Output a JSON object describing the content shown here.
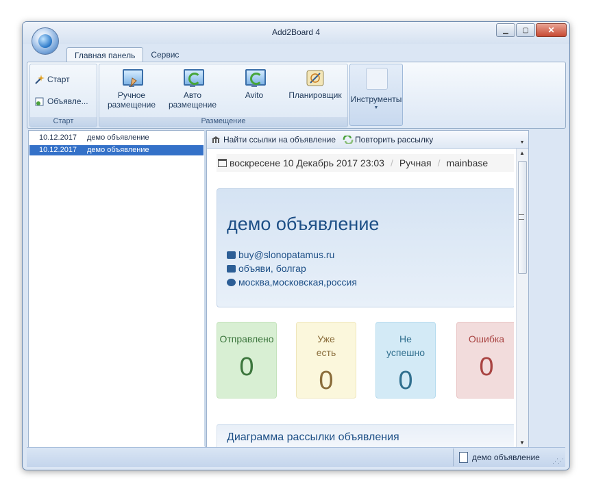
{
  "window": {
    "title": "Add2Board 4"
  },
  "tabs": [
    {
      "label": "Главная панель",
      "active": true
    },
    {
      "label": "Сервис",
      "active": false
    }
  ],
  "ribbon": {
    "start_group": {
      "label": "Старт",
      "buttons": [
        {
          "label": "Старт",
          "icon": "wizard-icon"
        },
        {
          "label": "Объявле...",
          "icon": "ad-icon"
        }
      ]
    },
    "placement_group": {
      "label": "Размещение",
      "buttons": [
        {
          "line1": "Ручное",
          "line2": "размещение",
          "icon": "manual-placement-icon"
        },
        {
          "line1": "Авто",
          "line2": "размещение",
          "icon": "auto-placement-icon"
        },
        {
          "line1": "Avito",
          "line2": "",
          "icon": "avito-icon"
        },
        {
          "line1": "Планировщик",
          "line2": "",
          "icon": "scheduler-icon"
        }
      ]
    },
    "tools": {
      "label": "Инструменты"
    }
  },
  "ads_list": [
    {
      "date": "10.12.2017",
      "title": "демо объявление",
      "selected": false
    },
    {
      "date": "10.12.2017",
      "title": "демо объявление",
      "selected": true
    }
  ],
  "detail_toolbar": {
    "find_links": "Найти ссылки на объявление",
    "repeat": "Повторить рассылку"
  },
  "detail": {
    "datetime": "воскресене 10 Декабрь 2017 23:03",
    "mode": "Ручная",
    "base": "mainbase",
    "title": "демо объявление",
    "email": "buy@slonopatamus.ru",
    "category": "объяви, болгар",
    "location": "москва,московская,россия",
    "stats": {
      "sent": {
        "label": "Отправлено",
        "value": "0",
        "color": "#3c763d"
      },
      "exists": {
        "line1": "Уже",
        "line2": "есть",
        "value": "0",
        "color": "#8a6d3b"
      },
      "failed": {
        "line1": "Не",
        "line2": "успешно",
        "value": "0",
        "color": "#31708f"
      },
      "error": {
        "label": "Ошибка",
        "value": "0",
        "color": "#a94442"
      }
    },
    "chart_title": "Диаграмма рассылки объявления"
  },
  "statusbar": {
    "current": "демо объявление"
  }
}
